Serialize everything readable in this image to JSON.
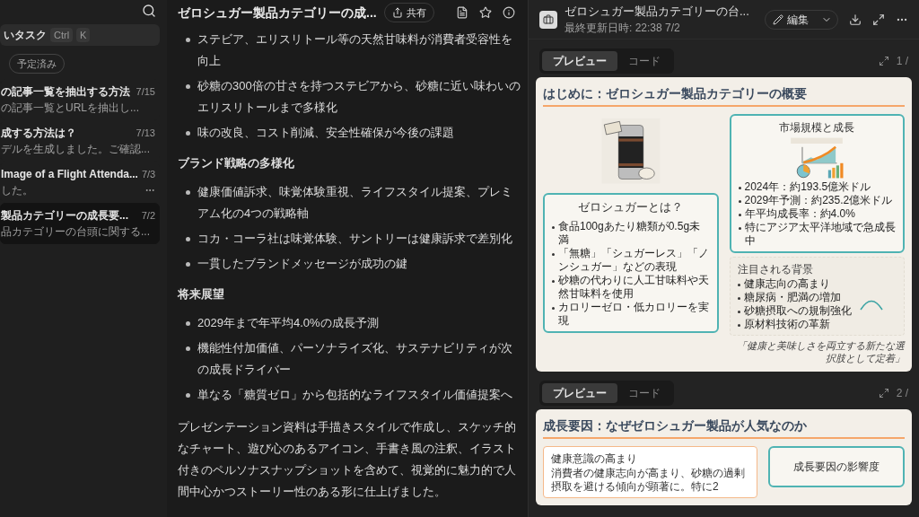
{
  "sidebar": {
    "search_placeholder": "いタスク",
    "shortcut": [
      "Ctrl",
      "K"
    ],
    "filters": [
      {
        "label": "予定済み",
        "selected": false
      }
    ],
    "tasks": [
      {
        "title": "の記事一覧を抽出する方法",
        "date": "7/15",
        "preview": "の記事一覧とURLを抽出し...",
        "selected": false,
        "has_menu": false
      },
      {
        "title": "成する方法は？",
        "date": "7/13",
        "preview": "デルを生成しました。ご確認...",
        "selected": false,
        "has_menu": false
      },
      {
        "title": "Image of a Flight Attenda...",
        "date": "7/3",
        "preview": "した。",
        "selected": false,
        "has_menu": true
      },
      {
        "title": "製品カテゴリーの成長要...",
        "date": "7/2",
        "preview": "品カテゴリーの台頭に関する...",
        "selected": true,
        "has_menu": false
      }
    ]
  },
  "chat": {
    "title": "ゼロシュガー製品カテゴリーの成...",
    "share_label": "共有",
    "blocks": [
      {
        "kind": "bullets",
        "items": [
          "ステビア、エリスリトール等の天然甘味料が消費者受容性を向上",
          "砂糖の300倍の甘さを持つステビアから、砂糖に近い味わいのエリスリトールまで多様化",
          "味の改良、コスト削減、安全性確保が今後の課題"
        ]
      },
      {
        "kind": "heading",
        "text": "ブランド戦略の多様化"
      },
      {
        "kind": "bullets",
        "items": [
          "健康価値訴求、味覚体験重視、ライフスタイル提案、プレミアム化の4つの戦略軸",
          "コカ・コーラ社は味覚体験、サントリーは健康訴求で差別化",
          "一貫したブランドメッセージが成功の鍵"
        ]
      },
      {
        "kind": "heading",
        "text": "将来展望"
      },
      {
        "kind": "bullets",
        "items": [
          "2029年まで年平均4.0%の成長予測",
          "機能性付加価値、パーソナライズ化、サステナビリティが次の成長ドライバー",
          "単なる「糖質ゼロ」から包括的なライフスタイル価値提案へ"
        ]
      },
      {
        "kind": "paragraph",
        "text": "プレゼンテーション資料は手描きスタイルで作成し、スケッチ的なチャート、遊び心のあるアイコン、手書き風の注釈、イラスト付きのペルソナスナップショットを含めて、視覚的に魅力的で人間中心かつストーリー性のある形に仕上げました。"
      }
    ]
  },
  "document": {
    "title": "ゼロシュガー製品カテゴリーの台...",
    "updated": "最終更新日時: 22:38 7/2",
    "edit_label": "編集",
    "slides": [
      {
        "tabs": [
          {
            "label": "プレビュー",
            "selected": true
          },
          {
            "label": "コード",
            "selected": false
          }
        ],
        "page": "1 /",
        "title": "はじめに：ゼロシュガー製品カテゴリーの概要",
        "definition": {
          "title": "ゼロシュガーとは？",
          "items": [
            "食品100gあたり糖類が0.5g未満",
            "「無糖」「シュガーレス」「ノンシュガー」などの表現",
            "砂糖の代わりに人工甘味料や天然甘味料を使用",
            "カロリーゼロ・低カロリーを実現"
          ]
        },
        "market": {
          "title": "市場規模と成長",
          "items": [
            "2024年：約193.5億米ドル",
            "2029年予測：約235.2億米ドル",
            "年平均成長率：約4.0%",
            "特にアジア太平洋地域で急成長中"
          ]
        },
        "background": {
          "title": "注目される背景",
          "items": [
            "健康志向の高まり",
            "糖尿病・肥満の増加",
            "砂糖摂取への規制強化",
            "原材料技術の革新"
          ]
        },
        "quote": "「健康と美味しさを両立する新たな選択肢として定着」"
      },
      {
        "tabs": [
          {
            "label": "プレビュー",
            "selected": true
          },
          {
            "label": "コード",
            "selected": false
          }
        ],
        "page": "2 /",
        "title": "成長要因：なぜゼロシュガー製品が人気なのか",
        "factor": {
          "title": "健康意識の高まり",
          "text": "消費者の健康志向が高まり、砂糖の過剰摂取を避ける傾向が顕著に。特に2"
        },
        "impact_title": "成長要因の影響度"
      }
    ]
  }
}
